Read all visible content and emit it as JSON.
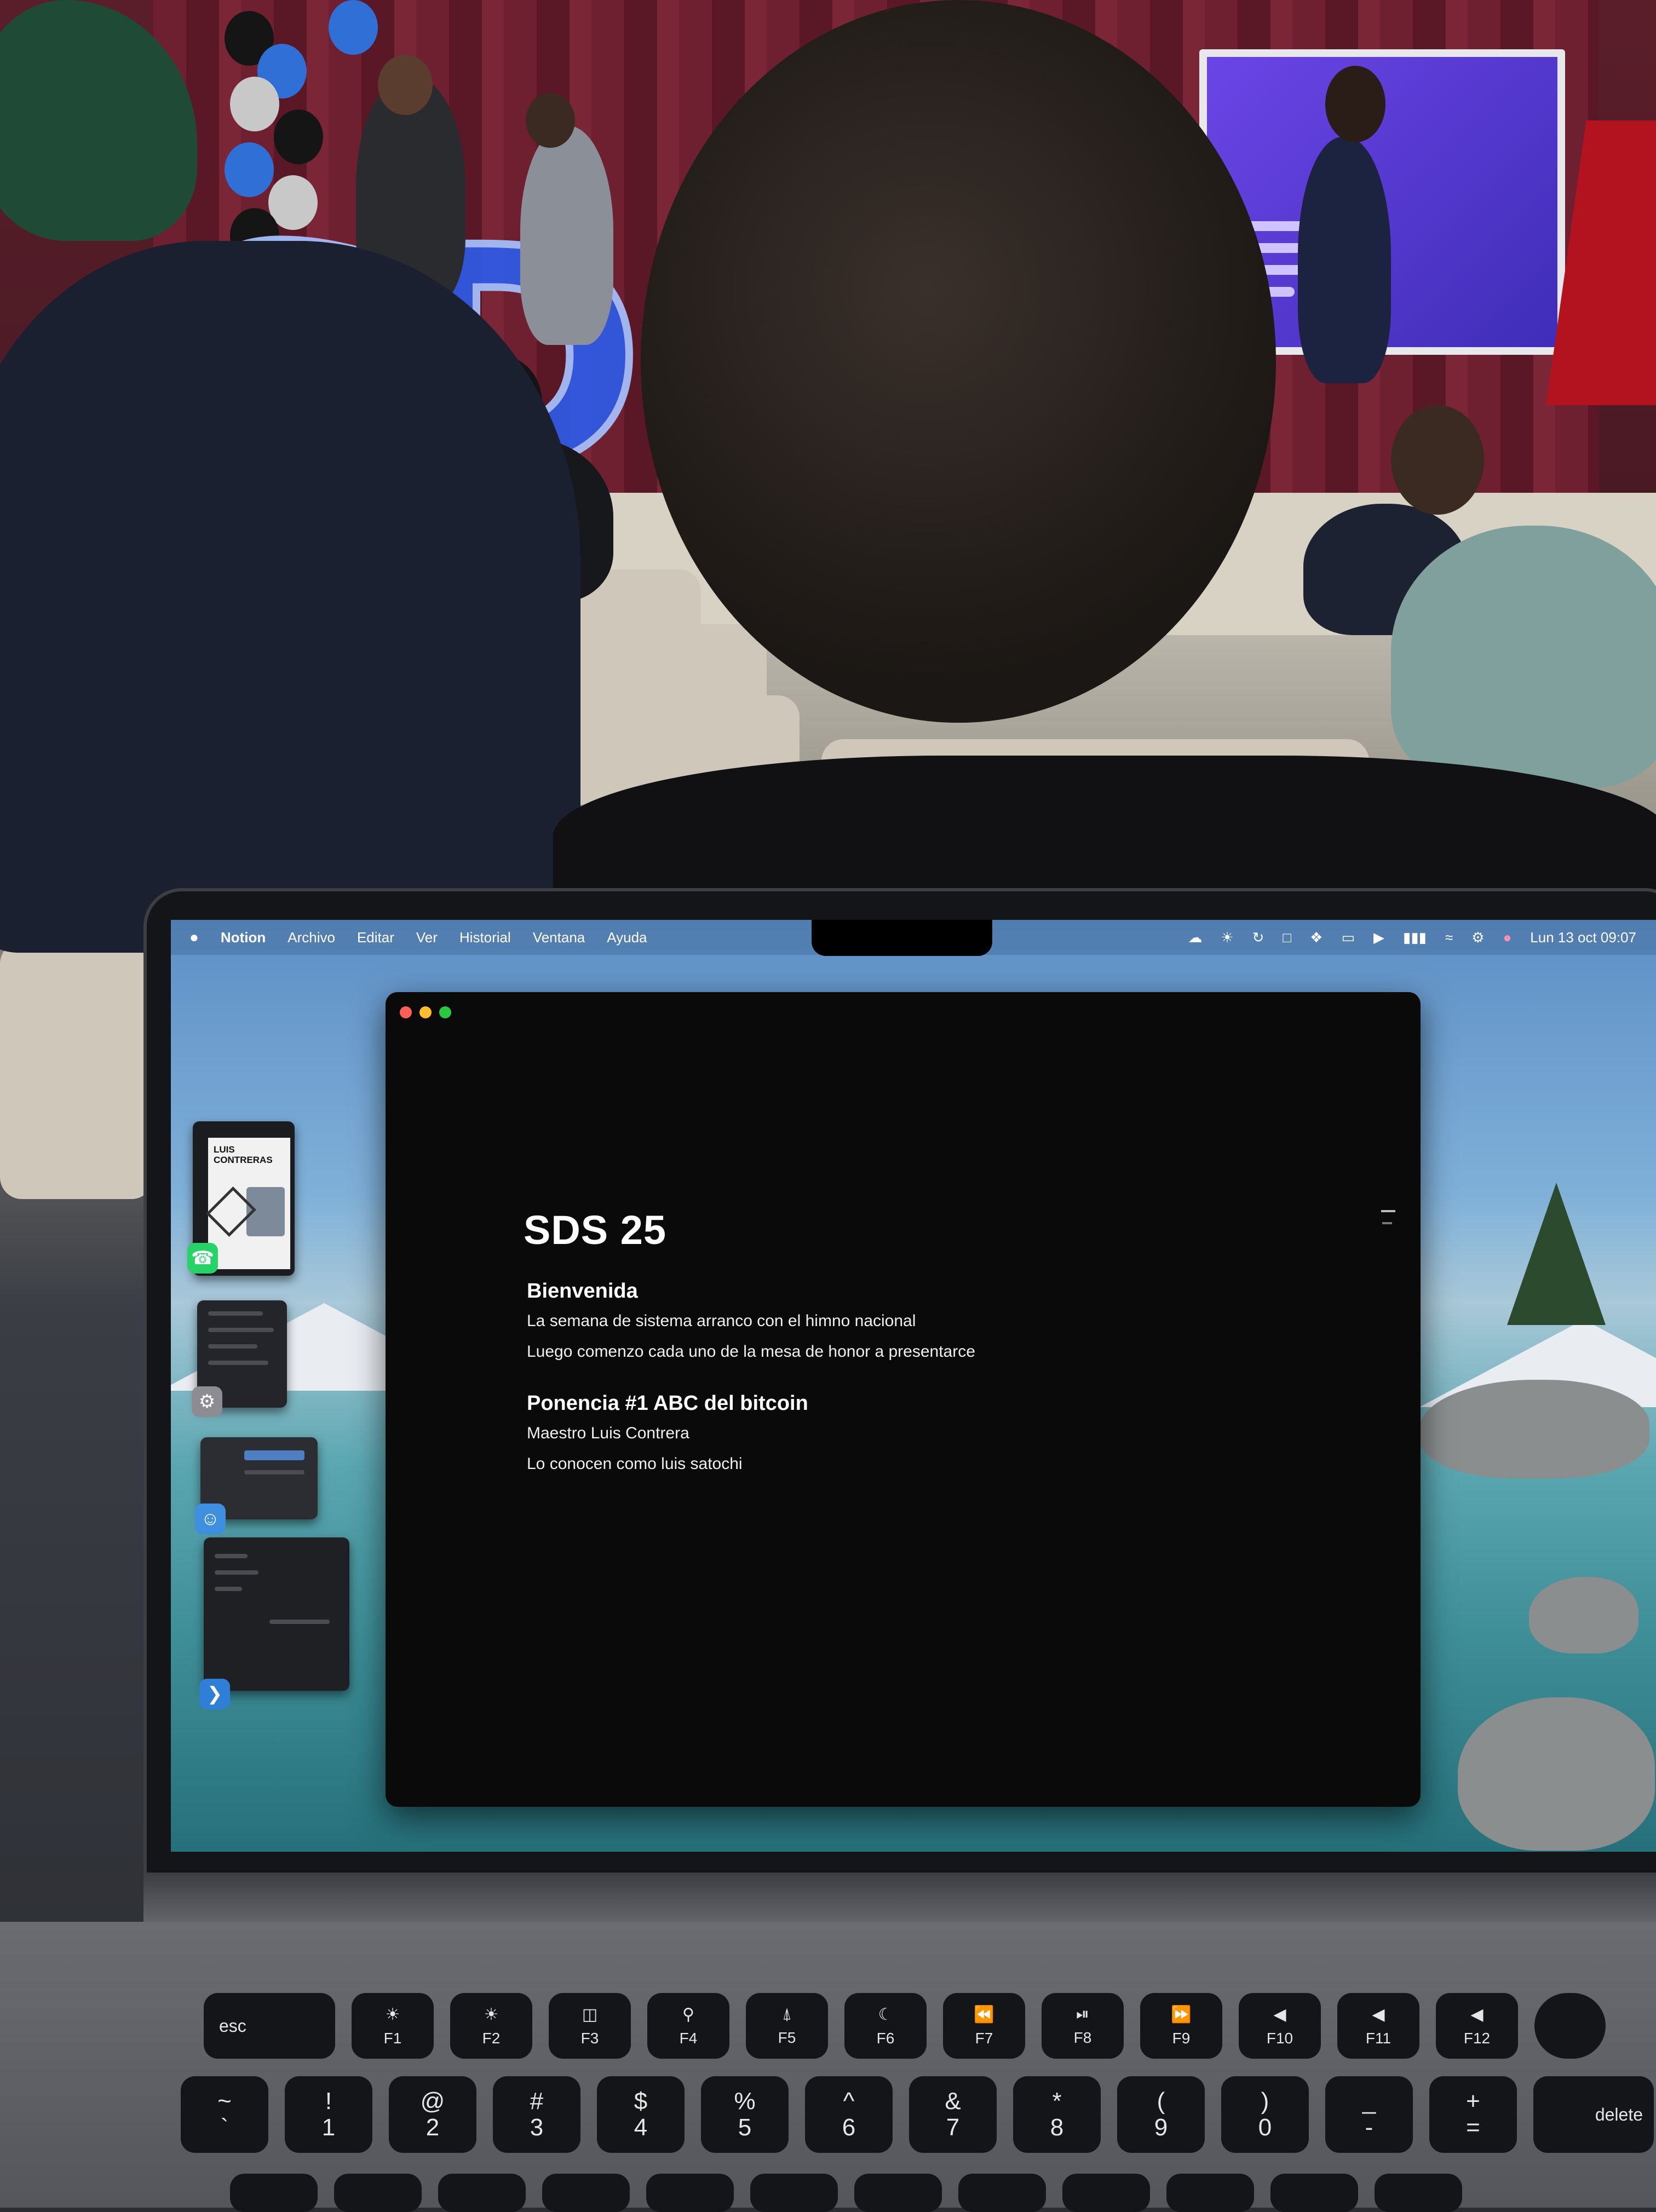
{
  "menubar": {
    "apple_icon": "apple-icon",
    "app_name": "Notion",
    "menus": [
      "Archivo",
      "Editar",
      "Ver",
      "Historial",
      "Ventana",
      "Ayuda"
    ],
    "clock": "Lun 13 oct 09:07"
  },
  "document": {
    "title": "SDS 25",
    "sections": [
      {
        "heading": "Bienvenida",
        "lines": [
          "La semana de sistema arranco con el himno nacional",
          "Luego comenzo cada uno de la mesa de honor a presentarce"
        ]
      },
      {
        "heading": "Ponencia #1 ABC del bitcoin",
        "lines": [
          "Maestro Luis Contrera",
          "Lo conocen como luis satochi"
        ]
      }
    ]
  },
  "stage_manager": {
    "poster_name": "LUIS CONTRERAS"
  },
  "keyboard": {
    "esc": "esc",
    "function_keys": [
      "F1",
      "F2",
      "F3",
      "F4",
      "F5",
      "F6",
      "F7",
      "F8",
      "F9",
      "F10",
      "F11",
      "F12"
    ],
    "number_keys": [
      {
        "top": "~",
        "bottom": "`"
      },
      {
        "top": "!",
        "bottom": "1"
      },
      {
        "top": "@",
        "bottom": "2"
      },
      {
        "top": "#",
        "bottom": "3"
      },
      {
        "top": "$",
        "bottom": "4"
      },
      {
        "top": "%",
        "bottom": "5"
      },
      {
        "top": "^",
        "bottom": "6"
      },
      {
        "top": "&",
        "bottom": "7"
      },
      {
        "top": "*",
        "bottom": "8"
      },
      {
        "top": "(",
        "bottom": "9"
      },
      {
        "top": ")",
        "bottom": "0"
      },
      {
        "top": "_",
        "bottom": "-"
      },
      {
        "top": "+",
        "bottom": "="
      }
    ],
    "delete": "delete"
  },
  "colors": {
    "window_bg": "#0a0a0a",
    "traffic_close": "#ff5f57",
    "traffic_min": "#febc2e",
    "traffic_max": "#28c840",
    "whatsapp": "#25d366",
    "vscode": "#2f7fd9"
  }
}
